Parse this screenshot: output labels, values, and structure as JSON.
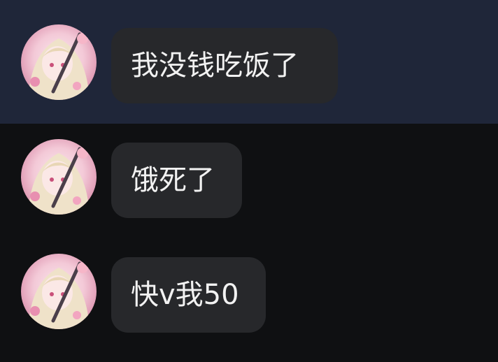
{
  "messages": [
    {
      "text": "我没钱吃饭了",
      "highlighted": true
    },
    {
      "text": "饿死了",
      "highlighted": false
    },
    {
      "text": "快v我50",
      "highlighted": false
    }
  ],
  "colors": {
    "background": "#0f1012",
    "highlight_row": "#1f2639",
    "bubble": "#27282b",
    "text": "#f2f2f2"
  },
  "avatar": {
    "icon": "anime-girl-avatar"
  }
}
